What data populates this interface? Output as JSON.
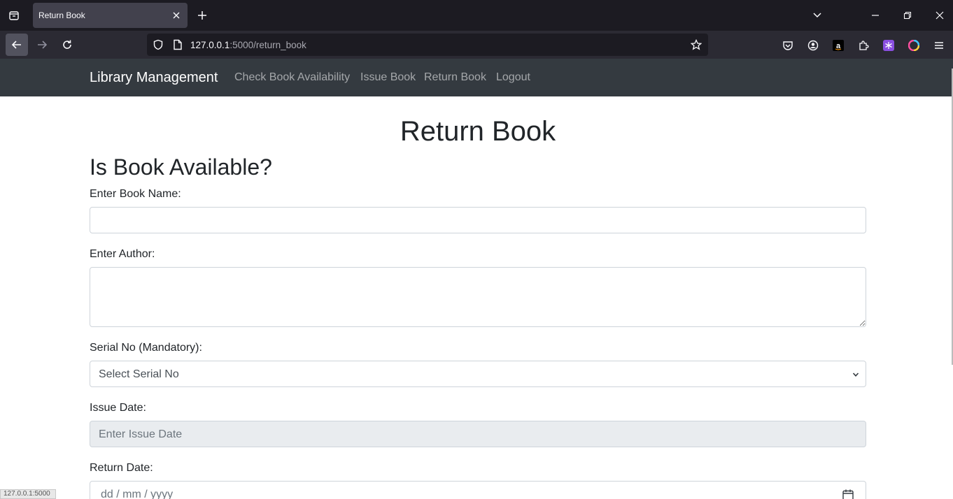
{
  "browser": {
    "tab_title": "Return Book",
    "url_host": "127.0.0.1",
    "url_rest": ":5000/return_book",
    "status_text": "127.0.0.1:5000"
  },
  "site": {
    "brand": "Library Management",
    "nav": [
      "Check Book Availability",
      "Issue Book",
      "Return Book",
      "Logout"
    ]
  },
  "page": {
    "title": "Return Book",
    "subtitle": "Is Book Available?"
  },
  "form": {
    "book_name_label": "Enter Book Name:",
    "book_name_value": "",
    "author_label": "Enter Author:",
    "author_value": "",
    "serial_label": "Serial No (Mandatory):",
    "serial_selected": "Select Serial No",
    "issue_label": "Issue Date:",
    "issue_placeholder": "Enter Issue Date",
    "return_label": "Return Date:",
    "return_placeholder": "dd / mm / yyyy"
  },
  "colors": {
    "navbar_bg": "#343a40",
    "chrome_bg": "#1c1b22",
    "toolbar_bg": "#2b2a33",
    "field_border": "#ced4da",
    "readonly_bg": "#e9ecef"
  }
}
